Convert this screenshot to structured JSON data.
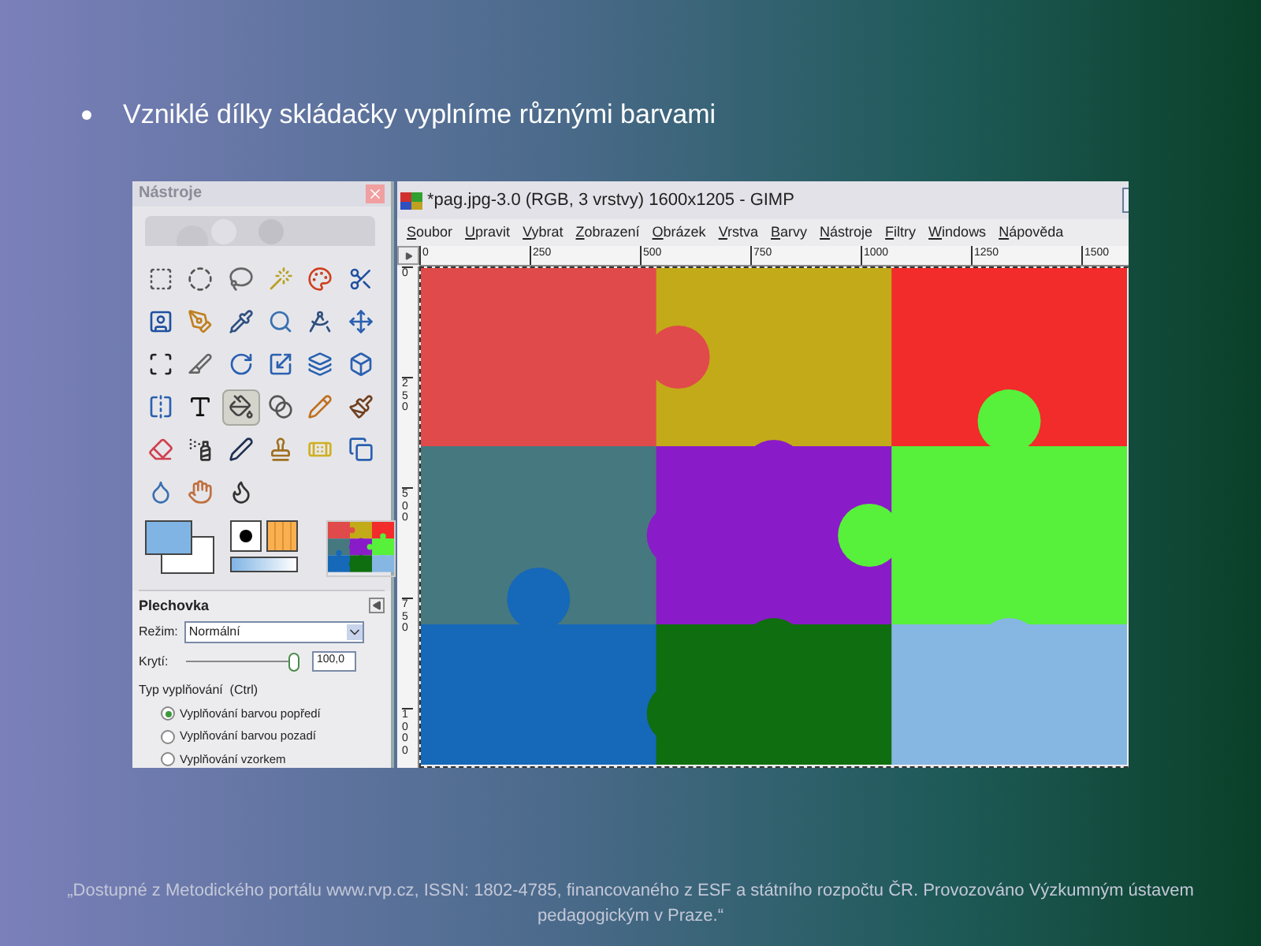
{
  "slide": {
    "bullet": "Vzniklé dílky skládačky vyplníme různými barvami",
    "footer": "„Dostupné z Metodického portálu www.rvp.cz, ISSN: 1802-4785, financovaného z ESF a státního rozpočtu ČR. Provozováno Výzkumným ústavem pedagogickým v Praze.“"
  },
  "toolbox": {
    "title": "Nástroje",
    "tools": [
      {
        "selected": false
      },
      {
        "selected": false
      },
      {
        "selected": false
      },
      {
        "selected": false
      },
      {
        "selected": false
      },
      {
        "selected": false
      },
      {
        "selected": false
      },
      {
        "selected": false
      },
      {
        "selected": false
      },
      {
        "selected": false
      },
      {
        "selected": false
      },
      {
        "selected": false
      },
      {
        "selected": false
      },
      {
        "selected": false
      },
      {
        "selected": false
      },
      {
        "selected": false
      },
      {
        "selected": false
      },
      {
        "selected": false
      },
      {
        "selected": false
      },
      {
        "selected": false
      },
      {
        "selected": true
      },
      {
        "selected": false
      },
      {
        "selected": false
      },
      {
        "selected": false
      },
      {
        "selected": false
      },
      {
        "selected": false
      },
      {
        "selected": false
      },
      {
        "selected": false
      },
      {
        "selected": false
      },
      {
        "selected": false
      },
      {
        "selected": false
      },
      {
        "selected": false
      },
      {
        "selected": false
      }
    ]
  },
  "tool_options": {
    "title": "Plechovka",
    "mode_label": "Režim:",
    "mode": "Normální",
    "opacity_label": "Krytí:",
    "opacity": {
      "level": 1
    },
    "opacity_value": "100,0",
    "fill_type_label": "Typ vyplňování  (Ctrl)",
    "fill_types": [
      {
        "label": "Vyplňování barvou popředí",
        "selected": true
      },
      {
        "label": "Vyplňování barvou pozadí",
        "selected": false
      },
      {
        "label": "Vyplňování vzorkem",
        "selected": false
      }
    ]
  },
  "image_window": {
    "title": "*pag.jpg-3.0 (RGB, 3 vrstvy) 1600x1205 - GIMP",
    "menu": [
      "Soubor",
      "Upravit",
      "Vybrat",
      "Zobrazení",
      "Obrázek",
      "Vrstva",
      "Barvy",
      "Nástroje",
      "Filtry",
      "Windows",
      "Nápověda"
    ],
    "hruler": [
      "0",
      "250",
      "500",
      "750",
      "1000",
      "1250",
      "1500"
    ],
    "vruler": [
      "0",
      "250",
      "500",
      "750",
      "1000"
    ],
    "pieces": [
      {
        "color": "#e04a4a"
      },
      {
        "color": "#c3aa18"
      },
      {
        "color": "#f22b2b"
      },
      {
        "color": "#467880"
      },
      {
        "color": "#8a1bc8"
      },
      {
        "color": "#57f03a"
      },
      {
        "color": "#1668b8"
      },
      {
        "color": "#0f6e0f"
      },
      {
        "color": "#86b6e2"
      }
    ]
  }
}
